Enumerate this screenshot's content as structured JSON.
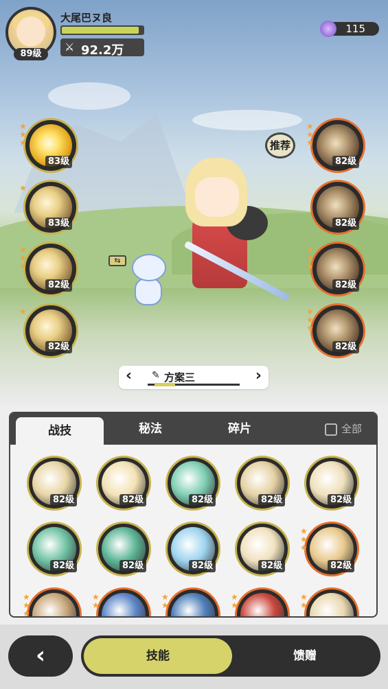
{
  "header": {
    "player_name": "大尾巴ヌ良",
    "player_level": "89级",
    "exp_fraction": 0.95,
    "power_label": "92.2万",
    "currency_value": "115"
  },
  "recommend_label": "推荐",
  "left_slots": [
    {
      "level": "83级",
      "stars": 3,
      "style": "gold"
    },
    {
      "level": "83级",
      "stars": 1,
      "style": "light"
    },
    {
      "level": "82级",
      "stars": 3,
      "style": "light"
    },
    {
      "level": "82级",
      "stars": 1,
      "style": "light"
    }
  ],
  "right_slots": [
    {
      "level": "82级",
      "stars": 3,
      "style": "brown"
    },
    {
      "level": "82级",
      "stars": 0,
      "style": "brown"
    },
    {
      "level": "82级",
      "stars": 3,
      "style": "brown"
    },
    {
      "level": "82级",
      "stars": 3,
      "style": "brown"
    }
  ],
  "plan": {
    "label": "方案三"
  },
  "panel": {
    "tabs": [
      "战技",
      "秘法",
      "碎片"
    ],
    "all_label": "全部"
  },
  "grid": [
    {
      "level": "82级",
      "color": "#e8d6a6",
      "stars": 0
    },
    {
      "level": "82级",
      "color": "#f3e2b4",
      "stars": 0
    },
    {
      "level": "82级",
      "color": "#7fcfb4",
      "stars": 0
    },
    {
      "level": "82级",
      "color": "#e5d1a3",
      "stars": 0
    },
    {
      "level": "82级",
      "color": "#efe0bb",
      "stars": 0
    },
    {
      "level": "82级",
      "color": "#6fc3a3",
      "stars": 0
    },
    {
      "level": "82级",
      "color": "#5db596",
      "stars": 0
    },
    {
      "level": "82级",
      "color": "#9fd4ef",
      "stars": 0
    },
    {
      "level": "82级",
      "color": "#f1e2bf",
      "stars": 0
    },
    {
      "level": "82级",
      "color": "#e9c98d",
      "stars": 3
    },
    {
      "level": "",
      "color": "#c9a77a",
      "stars": 3
    },
    {
      "level": "",
      "color": "#5d86c7",
      "stars": 2
    },
    {
      "level": "",
      "color": "#4f7fba",
      "stars": 2
    },
    {
      "level": "",
      "color": "#c9473d",
      "stars": 2
    },
    {
      "level": "",
      "color": "#e9d8b0",
      "stars": 2
    }
  ],
  "bottom": {
    "back_icon": "‹",
    "tab_skills": "技能",
    "tab_gift": "馈赠"
  }
}
